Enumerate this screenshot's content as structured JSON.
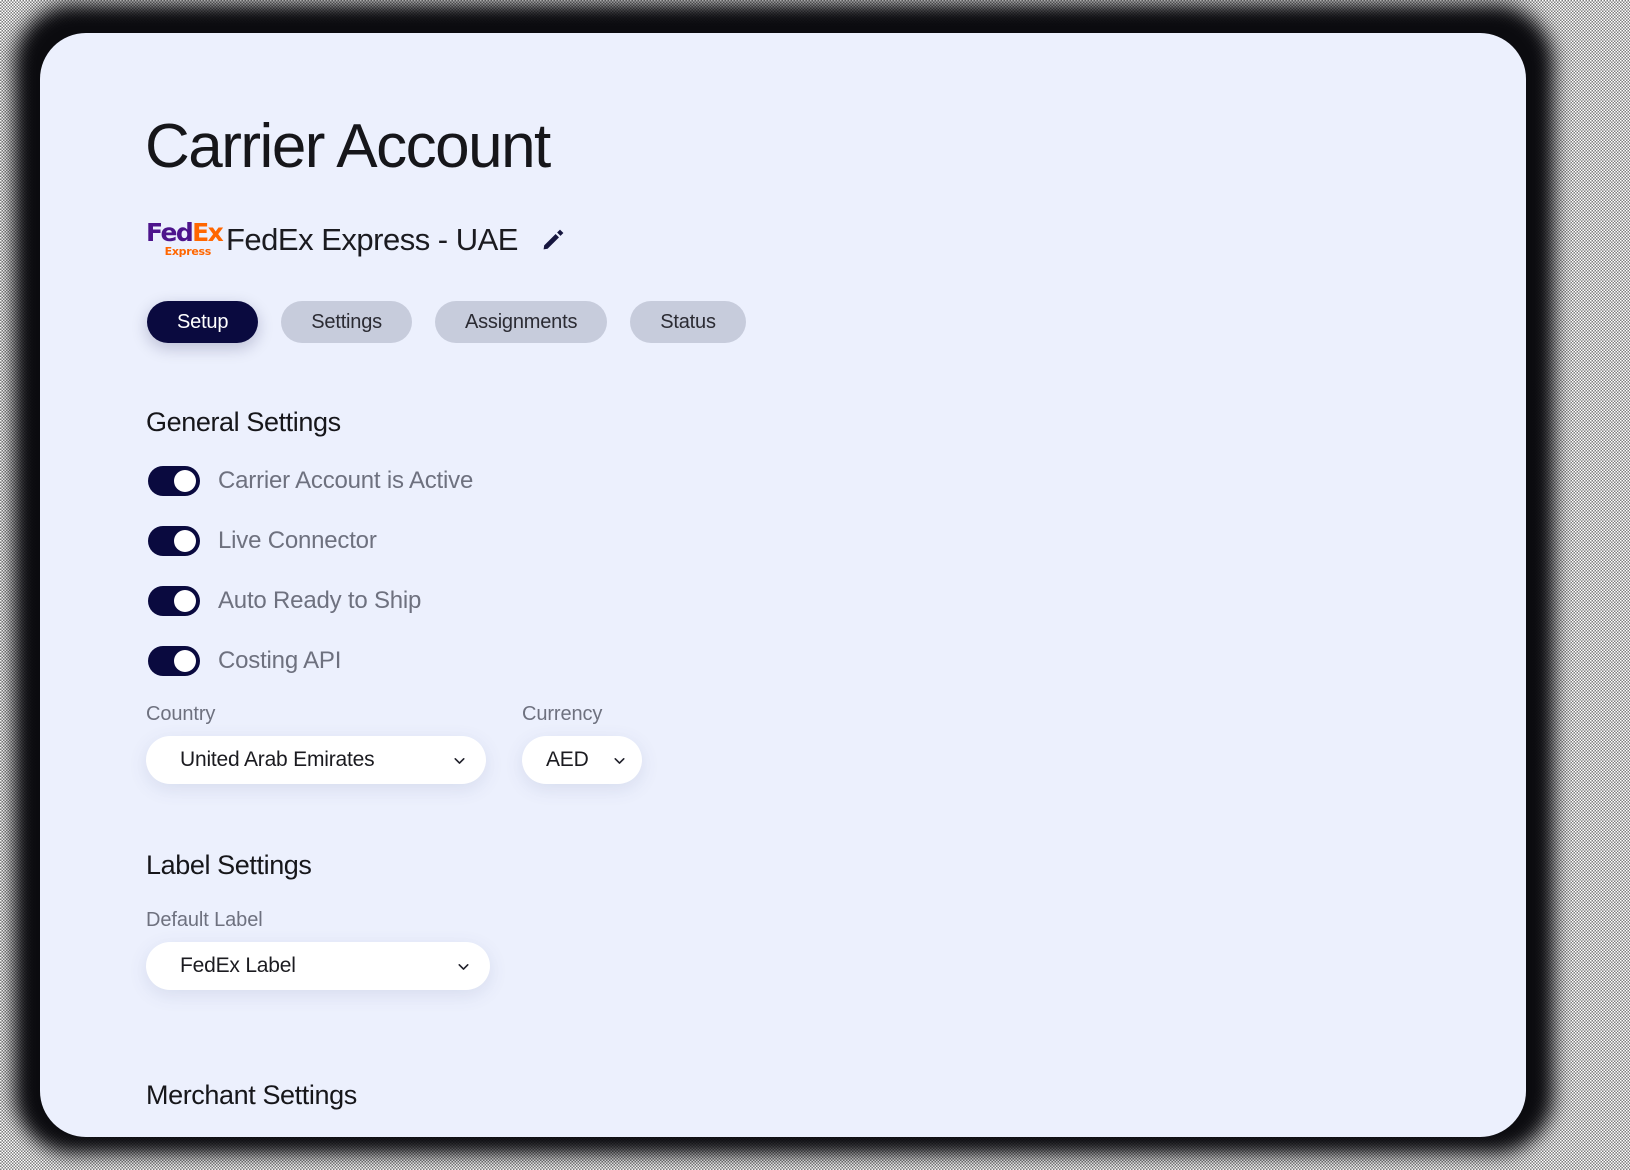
{
  "page": {
    "title": "Carrier Account"
  },
  "account": {
    "logo_icon": "fedex-logo",
    "logo_text_primary": "Fed",
    "logo_text_secondary": "Ex",
    "logo_subtext": "Express",
    "name": "FedEx Express - UAE",
    "edit_icon": "pencil-icon"
  },
  "tabs": [
    {
      "label": "Setup",
      "active": true
    },
    {
      "label": "Settings",
      "active": false
    },
    {
      "label": "Assignments",
      "active": false
    },
    {
      "label": "Status",
      "active": false
    }
  ],
  "general_settings": {
    "heading": "General Settings",
    "toggles": [
      {
        "label": "Carrier Account is Active",
        "on": true
      },
      {
        "label": "Live Connector",
        "on": true
      },
      {
        "label": "Auto Ready to Ship",
        "on": true
      },
      {
        "label": "Costing API",
        "on": true
      }
    ],
    "country": {
      "label": "Country",
      "value": "United Arab Emirates"
    },
    "currency": {
      "label": "Currency",
      "value": "AED"
    }
  },
  "label_settings": {
    "heading": "Label Settings",
    "default_label": {
      "label": "Default Label",
      "value": "FedEx Label"
    }
  },
  "merchant_settings": {
    "heading": "Merchant Settings"
  },
  "colors": {
    "page_background": "#ECF0FD",
    "accent_dark": "#0A0A3F",
    "tab_inactive": "#C7CCDC",
    "muted_text": "#6E717F",
    "fedex_purple": "#4D148C",
    "fedex_orange": "#FF6600",
    "surface_white": "#FFFFFF"
  }
}
